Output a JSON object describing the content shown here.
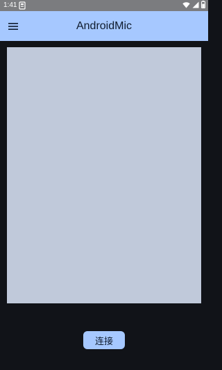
{
  "status_bar": {
    "time": "1:41",
    "icons": [
      "notification-icon",
      "wifi-icon",
      "signal-icon",
      "battery-icon"
    ]
  },
  "app_bar": {
    "title": "AndroidMic",
    "menu_icon": "hamburger-menu-icon"
  },
  "main": {
    "log_text": ""
  },
  "actions": {
    "connect_label": "连接"
  },
  "colors": {
    "status_bar": "#7b7c7f",
    "app_bar": "#a6c8ff",
    "background": "#111318",
    "panel": "#c0c9da",
    "button": "#a6c8ff",
    "on_primary": "#0f1b2d"
  }
}
